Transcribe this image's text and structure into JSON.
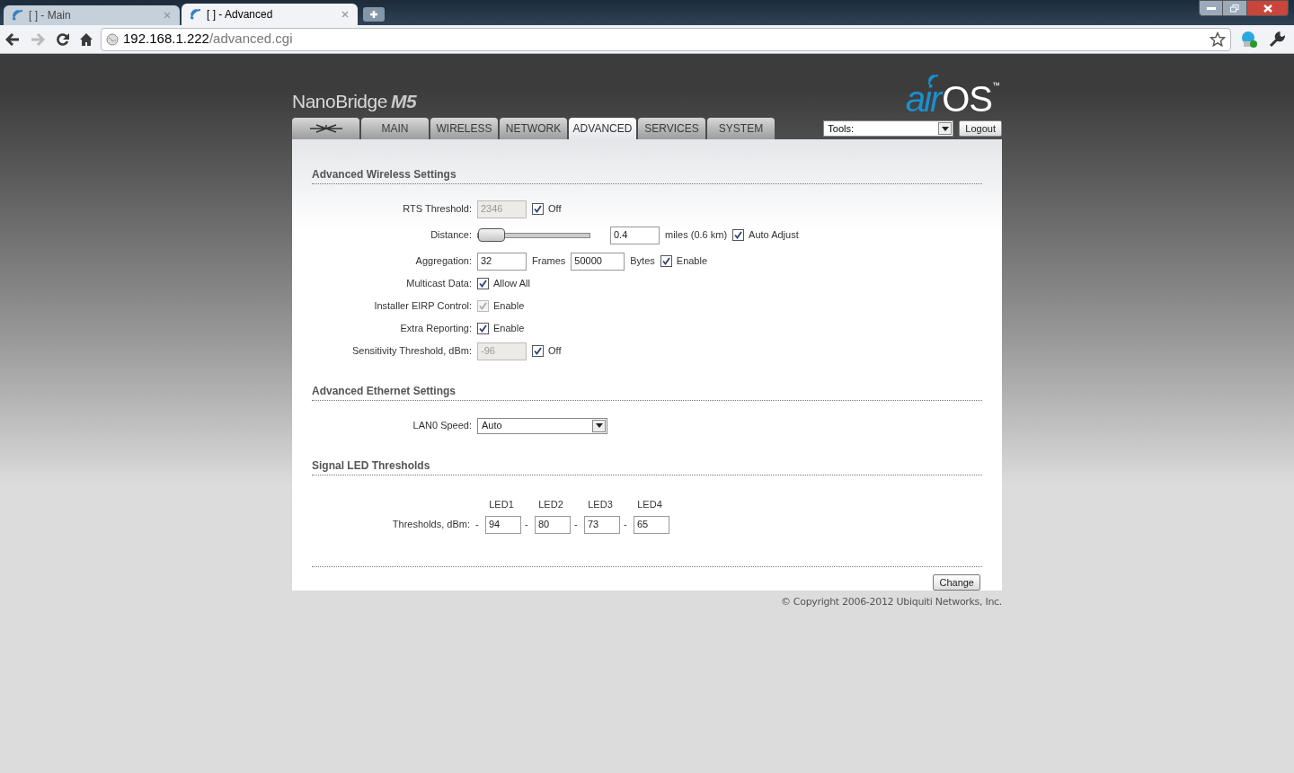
{
  "browser": {
    "tabs": [
      {
        "title": "[ ] - Main",
        "selected": false
      },
      {
        "title": "[ ] - Advanced",
        "selected": true
      }
    ],
    "address": {
      "host": "192.168.1.222",
      "path": "/advanced.cgi"
    }
  },
  "header": {
    "product": "NanoBridge",
    "model": "M5",
    "logo": {
      "air": "air",
      "os": "OS",
      "tm": "™"
    }
  },
  "nav": {
    "tabs": [
      {
        "kind": "logo",
        "selected": false
      },
      {
        "kind": "text",
        "label": "MAIN",
        "selected": false
      },
      {
        "kind": "text",
        "label": "WIRELESS",
        "selected": false
      },
      {
        "kind": "text",
        "label": "NETWORK",
        "selected": false
      },
      {
        "kind": "text",
        "label": "ADVANCED",
        "selected": true
      },
      {
        "kind": "text",
        "label": "SERVICES",
        "selected": false
      },
      {
        "kind": "text",
        "label": "SYSTEM",
        "selected": false
      }
    ],
    "tools": "Tools:",
    "logout": "Logout"
  },
  "sections": [
    {
      "title": "Advanced Wireless Settings",
      "rows": [
        {
          "label": "RTS Threshold:",
          "controls": [
            {
              "kind": "input",
              "value": "2346",
              "disabled": true
            },
            {
              "kind": "checkbox",
              "checked": true,
              "disabled": false,
              "label": "Off"
            }
          ]
        },
        {
          "label": "Distance:",
          "controls": [
            {
              "kind": "slider",
              "level": 0
            },
            {
              "kind": "input",
              "value": "0.4",
              "disabled": false
            },
            {
              "kind": "text",
              "text": "miles (0.6 km)"
            },
            {
              "kind": "checkbox",
              "checked": true,
              "disabled": false,
              "label": "Auto Adjust"
            }
          ]
        },
        {
          "label": "Aggregation:",
          "controls": [
            {
              "kind": "input",
              "value": "32",
              "disabled": false
            },
            {
              "kind": "text",
              "text": "Frames"
            },
            {
              "kind": "input",
              "value": "50000",
              "disabled": false
            },
            {
              "kind": "text",
              "text": "Bytes"
            },
            {
              "kind": "checkbox",
              "checked": true,
              "disabled": false,
              "label": "Enable"
            }
          ]
        },
        {
          "label": "Multicast Data:",
          "controls": [
            {
              "kind": "checkbox",
              "checked": true,
              "disabled": false,
              "label": "Allow All"
            }
          ]
        },
        {
          "label": "Installer EIRP Control:",
          "controls": [
            {
              "kind": "checkbox",
              "checked": true,
              "disabled": true,
              "label": "Enable"
            }
          ]
        },
        {
          "label": "Extra Reporting:",
          "controls": [
            {
              "kind": "checkbox",
              "checked": true,
              "disabled": false,
              "label": "Enable"
            }
          ]
        },
        {
          "label": "Sensitivity Threshold, dBm:",
          "controls": [
            {
              "kind": "input",
              "value": "-96",
              "disabled": true
            },
            {
              "kind": "checkbox",
              "checked": true,
              "disabled": false,
              "label": "Off"
            }
          ]
        }
      ]
    },
    {
      "title": "Advanced Ethernet Settings",
      "rows": [
        {
          "label": "LAN0 Speed:",
          "controls": [
            {
              "kind": "select",
              "value": "Auto"
            }
          ]
        }
      ]
    },
    {
      "title": "Signal LED Thresholds",
      "leds": {
        "headers": [
          "LED1",
          "LED2",
          "LED3",
          "LED4"
        ],
        "label": "Thresholds, dBm:",
        "values": [
          {
            "sign": "-",
            "value": "94"
          },
          {
            "sign": "-",
            "value": "80"
          },
          {
            "sign": "-",
            "value": "73"
          },
          {
            "sign": "-",
            "value": "65"
          }
        ]
      }
    }
  ],
  "change": "Change",
  "copyright": "© Copyright 2006-2012 Ubiquiti Networks, Inc."
}
